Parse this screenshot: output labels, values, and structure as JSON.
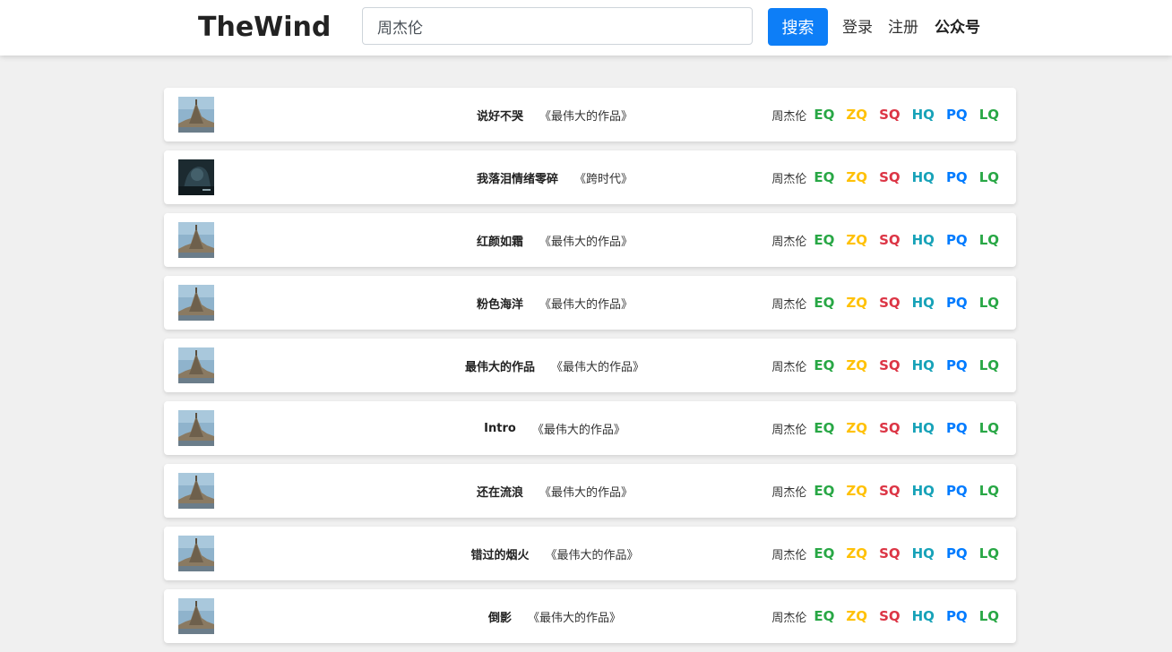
{
  "header": {
    "logo": "TheWind",
    "search_value": "周杰伦",
    "search_button": "搜索",
    "login": "登录",
    "register": "注册",
    "official_account": "公众号"
  },
  "colors": {
    "EQ": "#28a745",
    "ZQ": "#ffc107",
    "SQ": "#dc3545",
    "HQ": "#17a2b8",
    "PQ": "#007bff",
    "LQ": "#28a745",
    "search_button_bg": "#0d7ef7"
  },
  "quality_labels": [
    "EQ",
    "ZQ",
    "SQ",
    "HQ",
    "PQ",
    "LQ"
  ],
  "songs": [
    {
      "title": "说好不哭",
      "album": "《最伟大的作品》",
      "artist": "周杰伦",
      "cover": "castle-cover-icon"
    },
    {
      "title": "我落泪情绪零碎",
      "album": "《跨时代》",
      "artist": "周杰伦",
      "cover": "dark-portrait-cover-icon"
    },
    {
      "title": "红颜如霜",
      "album": "《最伟大的作品》",
      "artist": "周杰伦",
      "cover": "castle-cover-icon"
    },
    {
      "title": "粉色海洋",
      "album": "《最伟大的作品》",
      "artist": "周杰伦",
      "cover": "castle-cover-icon"
    },
    {
      "title": "最伟大的作品",
      "album": "《最伟大的作品》",
      "artist": "周杰伦",
      "cover": "castle-cover-icon"
    },
    {
      "title": "Intro",
      "album": "《最伟大的作品》",
      "artist": "周杰伦",
      "cover": "castle-cover-icon"
    },
    {
      "title": "还在流浪",
      "album": "《最伟大的作品》",
      "artist": "周杰伦",
      "cover": "castle-cover-icon"
    },
    {
      "title": "错过的烟火",
      "album": "《最伟大的作品》",
      "artist": "周杰伦",
      "cover": "castle-cover-icon"
    },
    {
      "title": "倒影",
      "album": "《最伟大的作品》",
      "artist": "周杰伦",
      "cover": "castle-cover-icon"
    }
  ]
}
